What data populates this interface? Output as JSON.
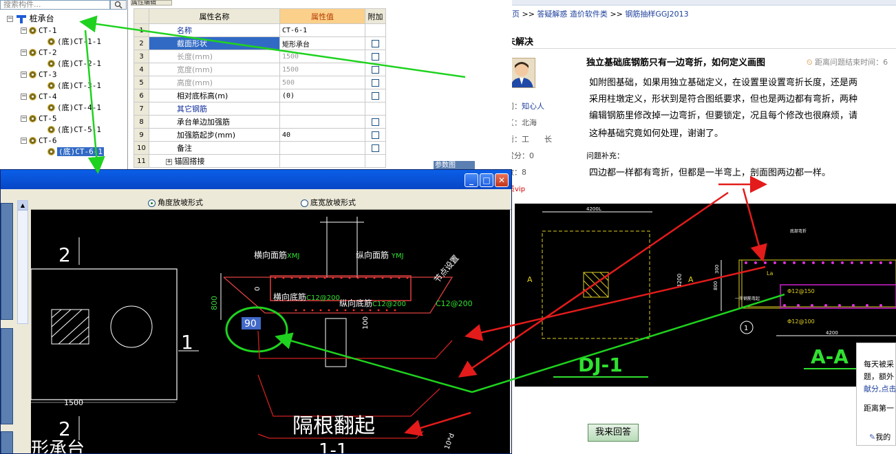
{
  "tree": {
    "search_placeholder": "搜索构件...",
    "root": "桩承台",
    "items": [
      {
        "name": "CT-1",
        "child": "(底)CT-1-1"
      },
      {
        "name": "CT-2",
        "child": "(底)CT-2-1"
      },
      {
        "name": "CT-3",
        "child": "(底)CT-3-1"
      },
      {
        "name": "CT-4",
        "child": "(底)CT-4-1"
      },
      {
        "name": "CT-5",
        "child": "(底)CT-5-1"
      },
      {
        "name": "CT-6",
        "child": "(底)CT-6-1"
      }
    ]
  },
  "props": {
    "tab_label": "属性编辑",
    "headers": {
      "name": "属性名称",
      "value": "属性值",
      "extra": "附加"
    },
    "rows": [
      {
        "num": "1",
        "name": "名称",
        "value": "CT-6-1"
      },
      {
        "num": "2",
        "name": "截面形状",
        "value": "矩形承台"
      },
      {
        "num": "3",
        "name": "长度(mm)",
        "value": "1500"
      },
      {
        "num": "4",
        "name": "宽度(mm)",
        "value": "1500"
      },
      {
        "num": "5",
        "name": "高度(mm)",
        "value": "500"
      },
      {
        "num": "6",
        "name": "相对底标高(m)",
        "value": "(0)"
      },
      {
        "num": "7",
        "name": "其它钢筋",
        "value": ""
      },
      {
        "num": "8",
        "name": "承台单边加强筋",
        "value": ""
      },
      {
        "num": "9",
        "name": "加强筋起步(mm)",
        "value": "40"
      },
      {
        "num": "10",
        "name": "备注",
        "value": ""
      },
      {
        "num": "11",
        "name": "锚固搭接",
        "value": ""
      }
    ],
    "side_tab": "参数图"
  },
  "dialog": {
    "radio_angle": "角度放坡形式",
    "radio_width": "底宽放坡形式",
    "drawing": {
      "top_mesh": "横向面筋",
      "top_mesh_code": "XMJ",
      "long_mesh": "纵向面筋",
      "long_mesh_code": "YMJ",
      "node": "节点设置",
      "bottom_mesh": "横向底筋",
      "bottom_mesh_code": "C12@200",
      "long_bottom": "纵向底筋",
      "long_bottom_code": "C12@200",
      "side_code": "C12@200",
      "angle_input": "90",
      "dim_800": "800",
      "dim_100": "100",
      "dim_0": "0",
      "dim_1500": "1500",
      "dim_10d": "10*d",
      "label_2a": "2",
      "label_1": "1",
      "label_2b": "2",
      "partial_text": "形承台",
      "note": "隔根翻起",
      "section": "1-1"
    }
  },
  "web": {
    "breadcrumb": [
      "页",
      ">>",
      "答疑解惑",
      "造价软件类",
      ">>",
      "钢筋抽样GGJ2013"
    ],
    "status": "未解决",
    "question_title": "独立基础底钢筋只有一边弯折，如何定义画图",
    "timer": "距离问题结束时间：6",
    "body_lines": [
      "如附图基础，如果用独立基础定义，在设置里设置弯折长度，还是两",
      "采用柱墩定义，形状到是符合图纸要求，但也是两边都有弯折，两种",
      "编辑钢筋里修改掉一边弯折，但要锁定，况且每个修改也很麻烦，请",
      "这种基础究竟如何处理，谢谢了。"
    ],
    "meta": [
      {
        "label": "问：",
        "value": "知心人"
      },
      {
        "label": "区：",
        "value": "北海"
      },
      {
        "label": "衔：",
        "value": "工　　长"
      },
      {
        "label": "赏分：",
        "value": "0"
      },
      {
        "label": "数：",
        "value": "8"
      }
    ],
    "vip": "员vip",
    "supp_label": "问题补充：",
    "supp_text": "四边都一样都有弯折，但都是一半弯上，剖面图两边都一样。",
    "cad": {
      "dim_4200_top": "4200L",
      "dim_4200_side": "4200",
      "label_a": "A",
      "label_a2": "A",
      "title_left": "DJ-1",
      "title_right": "A-A",
      "rebar1": "Φ12@150",
      "rebar2": "Φ12@100",
      "dim_4200_bottom": "4200",
      "la": "La",
      "circle_1": "1",
      "dim_300": "300",
      "dim_800": "800",
      "note1": "一半钢筋弯起",
      "note2": "底部弯折"
    },
    "answer_button": "我来回答",
    "popup_lines": [
      "每天被采",
      "题，额外",
      "献分,点击",
      "距离第一",
      "我的"
    ]
  },
  "colors": {
    "accent_green": "#1fd21f",
    "accent_red": "#e41b1b",
    "titlebar": "#0a5fe8"
  }
}
